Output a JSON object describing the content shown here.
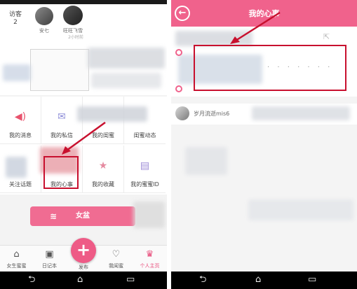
{
  "left": {
    "visitors": {
      "label": "访客",
      "count": "2",
      "avatars": [
        {
          "name": "安七"
        },
        {
          "name": "旺旺飞雪",
          "sub": "2小时前"
        }
      ]
    },
    "grid": [
      {
        "label": "我的消息",
        "icon": "speaker-icon"
      },
      {
        "label": "我的私信",
        "icon": "envelope-icon"
      },
      {
        "label": "我的闺蜜",
        "icon": "friends-icon"
      },
      {
        "label": "闺蜜动态",
        "icon": "feed-icon"
      },
      {
        "label": "关注话题",
        "icon": "topic-icon"
      },
      {
        "label": "我的心事",
        "icon": "heart-note-icon"
      },
      {
        "label": "我的收藏",
        "icon": "star-icon"
      },
      {
        "label": "我的蜜蜜ID",
        "icon": "id-card-icon"
      }
    ],
    "pill_button": "女盆",
    "tabs": [
      {
        "label": "女生蜜蜜",
        "icon": "home-icon"
      },
      {
        "label": "日记本",
        "icon": "notebook-icon"
      },
      {
        "label": "发布",
        "icon": "plus-icon"
      },
      {
        "label": "我闺蜜",
        "icon": "heart-icon"
      },
      {
        "label": "个人主页",
        "icon": "profile-icon"
      }
    ],
    "fab_symbol": "+",
    "navbar": {
      "back": "⮌",
      "home": "⌂",
      "recent": "▭"
    }
  },
  "right": {
    "title": "我的心事",
    "back_symbol": "←",
    "placeholder_dots": ". . . . . . .",
    "comment_user": "岁月流逝mis6",
    "share_symbol": "⇱",
    "navbar": {
      "back": "⮌",
      "home": "⌂",
      "recent": "▭"
    }
  },
  "colors": {
    "accent": "#f0628c",
    "highlight_box": "#c8102e"
  }
}
